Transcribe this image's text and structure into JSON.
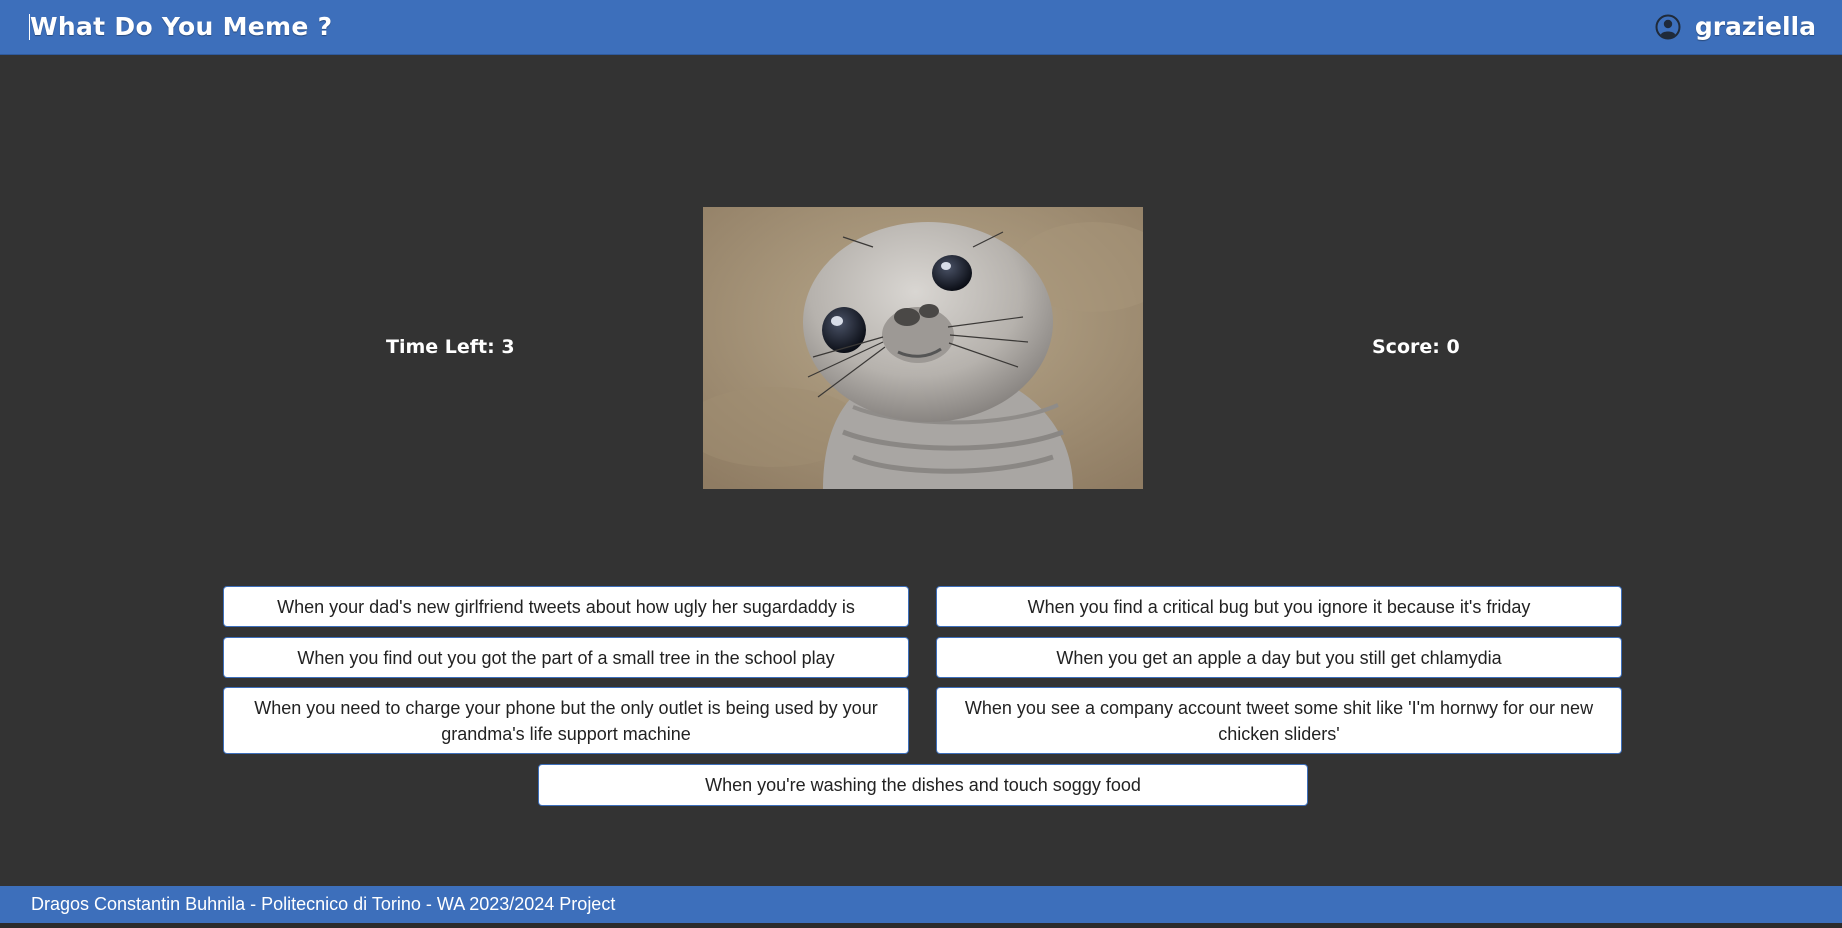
{
  "header": {
    "title": "What Do You Meme ?",
    "username": "graziella",
    "user_icon": "user-circle-icon"
  },
  "game": {
    "time_left": "Time Left: 3",
    "score": "Score: 0",
    "meme_image": "awkward-seal-meme"
  },
  "captions": [
    "When your dad's new girlfriend tweets about how ugly her sugardaddy is",
    "When you find a critical bug but you ignore it because it's friday",
    "When you find out you got the part of a small tree in the school play",
    "When you get an apple a day but you still get chlamydia",
    "When you need to charge your phone but the only outlet is being used by your grandma's life support machine",
    "When you see a company account tweet some shit like 'I'm hornwy for our new chicken sliders'",
    "When you're washing the dishes and touch soggy food"
  ],
  "footer": {
    "text": "Dragos Constantin Buhnila - Politecnico di Torino - WA 2023/2024 Project"
  },
  "colors": {
    "accent": "#3d6fbb",
    "background": "#333333"
  }
}
